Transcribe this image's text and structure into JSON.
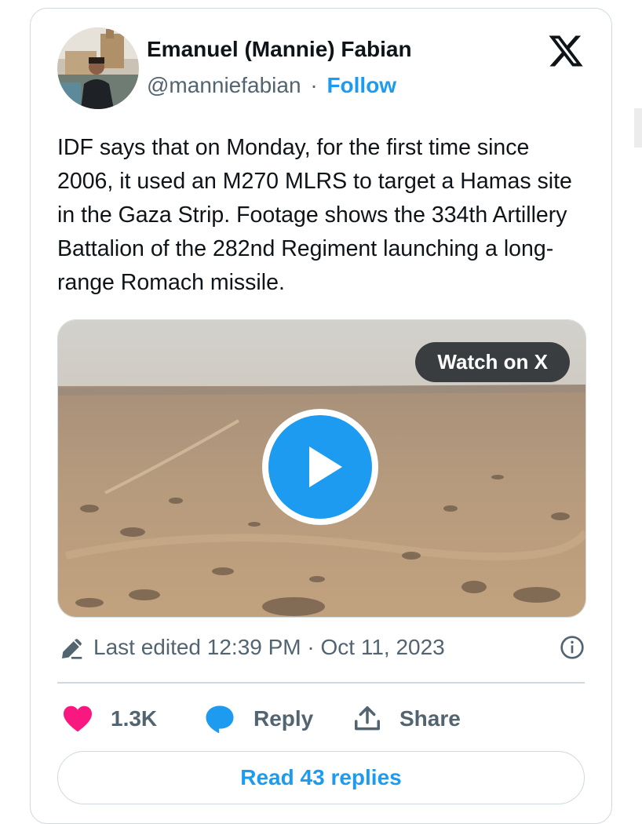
{
  "author": {
    "name": "Emanuel (Mannie) Fabian",
    "handle": "@manniefabian",
    "separator": "·",
    "follow_label": "Follow"
  },
  "platform_icon": "x-logo-icon",
  "tweet": {
    "text": "IDF says that on Monday, for the first time since 2006, it used an M270 MLRS to target a Hamas site in the Gaza Strip. Footage shows the 334th Artillery Battalion of the 282nd Regiment launching a long-range Romach missile."
  },
  "media": {
    "watch_label": "Watch on X",
    "play_icon": "play-icon"
  },
  "meta": {
    "edited_text": "Last edited 12:39 PM · Oct 11, 2023",
    "edit_icon": "pencil-icon",
    "info_icon": "info-icon"
  },
  "actions": {
    "like_count": "1.3K",
    "like_icon": "heart-icon",
    "reply_label": "Reply",
    "reply_icon": "reply-bubble-icon",
    "share_label": "Share",
    "share_icon": "share-upload-icon"
  },
  "read_replies_label": "Read 43 replies",
  "colors": {
    "accent": "#1d9bf0",
    "like": "#f91880",
    "text": "#0f1419",
    "muted": "#536471",
    "border": "#cfd9de"
  }
}
